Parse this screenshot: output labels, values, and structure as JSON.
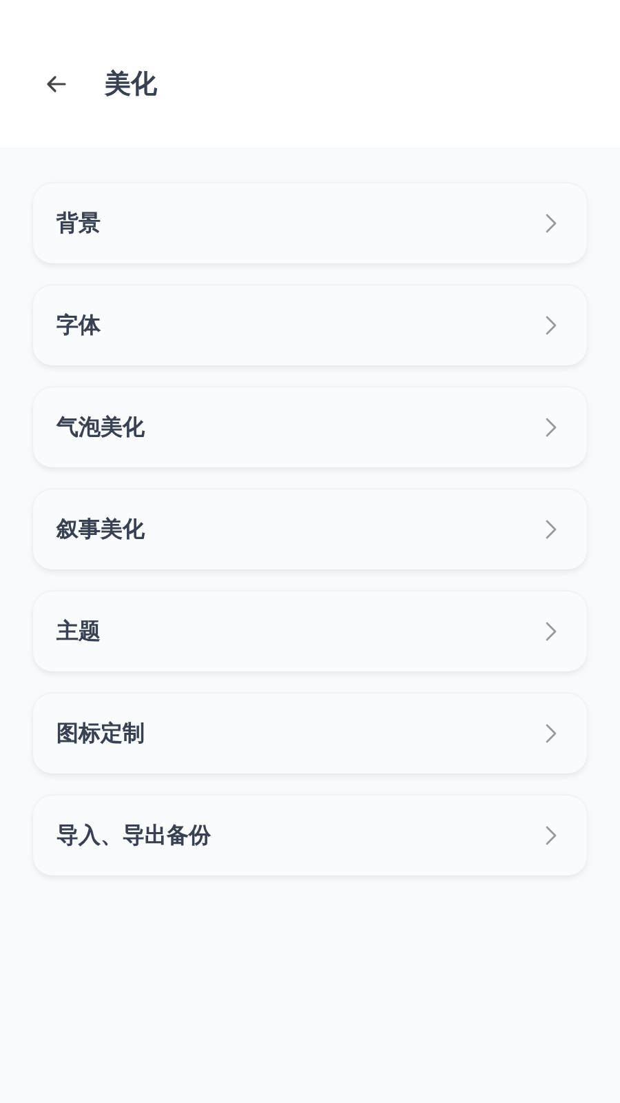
{
  "header": {
    "title": "美化"
  },
  "items": [
    {
      "label": "背景"
    },
    {
      "label": "字体"
    },
    {
      "label": "气泡美化"
    },
    {
      "label": "叙事美化"
    },
    {
      "label": "主题"
    },
    {
      "label": "图标定制"
    },
    {
      "label": "导入、导出备份"
    }
  ]
}
